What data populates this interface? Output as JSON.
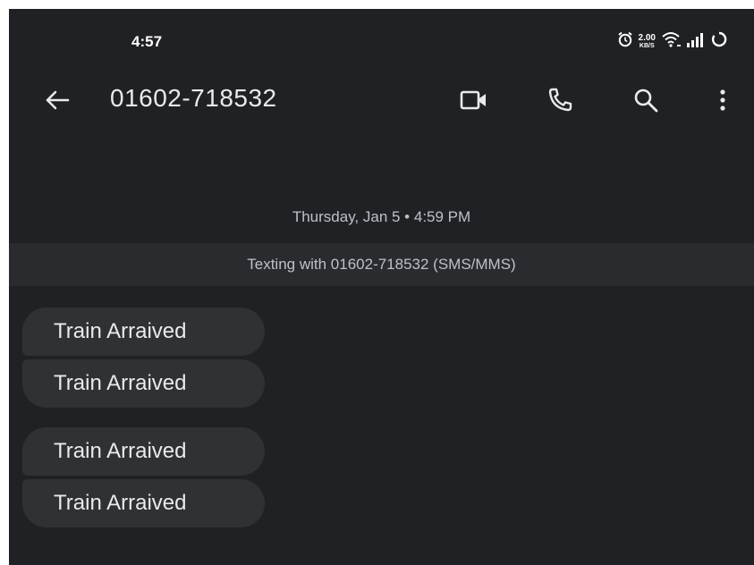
{
  "status_bar": {
    "time": "4:57",
    "net_speed_value": "2.00",
    "net_speed_unit": "KB/S",
    "icons": [
      "alarm-icon",
      "wifi-icon",
      "signal-icon",
      "battery-saver-icon"
    ]
  },
  "app_bar": {
    "title": "01602-718532",
    "icons": [
      "back-arrow-icon",
      "video-call-icon",
      "phone-icon",
      "search-icon",
      "more-vert-icon"
    ]
  },
  "conversation": {
    "date_label": "Thursday, Jan 5 • 4:59 PM",
    "sms_banner": "Texting with 01602-718532 (SMS/MMS)",
    "messages": [
      {
        "text": "Train Arraived"
      },
      {
        "text": "Train Arraived"
      },
      {
        "text": "Train Arraived"
      },
      {
        "text": "Train Arraived"
      }
    ]
  },
  "colors": {
    "background": "#202124",
    "bubble": "#303134",
    "banner": "#2a2b2e",
    "text": "#e8eaed",
    "muted_text": "#bdc1c6"
  }
}
